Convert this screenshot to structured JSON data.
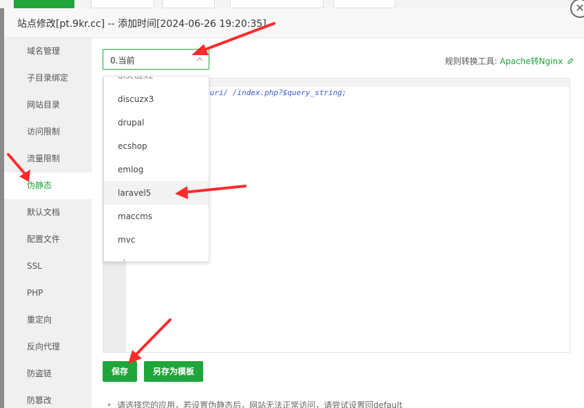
{
  "dialog": {
    "title": "站点修改[pt.9kr.cc] -- 添加时间[2024-06-26 19:20:35]"
  },
  "sidebar": {
    "items": [
      {
        "label": "域名管理"
      },
      {
        "label": "子目录绑定"
      },
      {
        "label": "网站目录"
      },
      {
        "label": "访问限制"
      },
      {
        "label": "流量限制"
      },
      {
        "label": "伪静态",
        "active": true
      },
      {
        "label": "默认文档"
      },
      {
        "label": "配置文件"
      },
      {
        "label": "SSL"
      },
      {
        "label": "PHP"
      },
      {
        "label": "重定向"
      },
      {
        "label": "反向代理"
      },
      {
        "label": "防盗链"
      },
      {
        "label": "防篡改"
      }
    ]
  },
  "rewrite": {
    "selected": "0.当前",
    "tool_label": "规则转换工具:",
    "tool_link": "Apache转Nginx",
    "code_tail": "$uri/ /index.php?$query_string;",
    "options": [
      "discuzx3",
      "drupal",
      "ecshop",
      "emlog",
      "laravel5",
      "maccms",
      "mvc"
    ],
    "highlighted": "laravel5"
  },
  "buttons": {
    "save": "保存",
    "save_template": "另存为模板"
  },
  "hint": "请选择您的应用，若设置伪静态后，网站无法正常访问，请尝试设置回default",
  "colors": {
    "accent": "#20a53a",
    "arrow": "#ff2a2a"
  }
}
